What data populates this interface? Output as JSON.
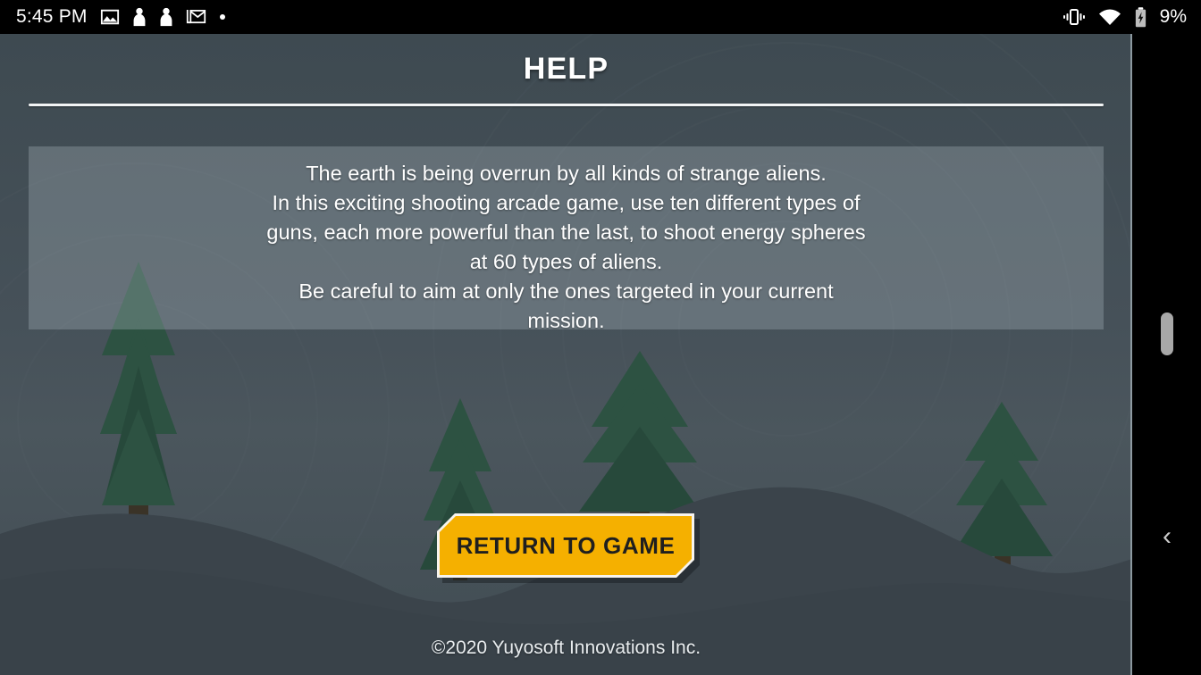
{
  "status_bar": {
    "time": "5:45 PM",
    "battery_percent": "9%",
    "left_icons": [
      {
        "name": "image-icon"
      },
      {
        "name": "notification-person-icon"
      },
      {
        "name": "notification-person-icon-2"
      },
      {
        "name": "gmail-icon"
      },
      {
        "name": "more-notifications-dot-icon"
      }
    ],
    "right_icons": [
      {
        "name": "vibrate-icon"
      },
      {
        "name": "wifi-icon"
      },
      {
        "name": "battery-charging-icon"
      }
    ]
  },
  "screen": {
    "title": "HELP",
    "help_body": "The earth is being overrun by all kinds of strange aliens.\nIn this exciting shooting arcade game, use ten different types of\nguns, each more powerful than the last, to shoot energy spheres\nat 60 types of aliens.\nBe careful to aim at only the ones targeted in your current\nmission.",
    "return_button": "RETURN TO GAME",
    "footer": "©2020 Yuyosoft Innovations Inc."
  },
  "system_rail": {
    "scrollbar_name": "scrollbar-thumb",
    "back_label": "‹"
  },
  "colors": {
    "background": "#3f4b52",
    "panel": "#6d7b82",
    "button_fill": "#f5b000",
    "button_border": "#f7f4ee",
    "button_text": "#1f1f1f",
    "title_text": "#ffffff",
    "tree_dark": "#2d5242",
    "tree_trunk": "#3a3327",
    "ground": "#3b444b",
    "status_bar": "#000000"
  }
}
